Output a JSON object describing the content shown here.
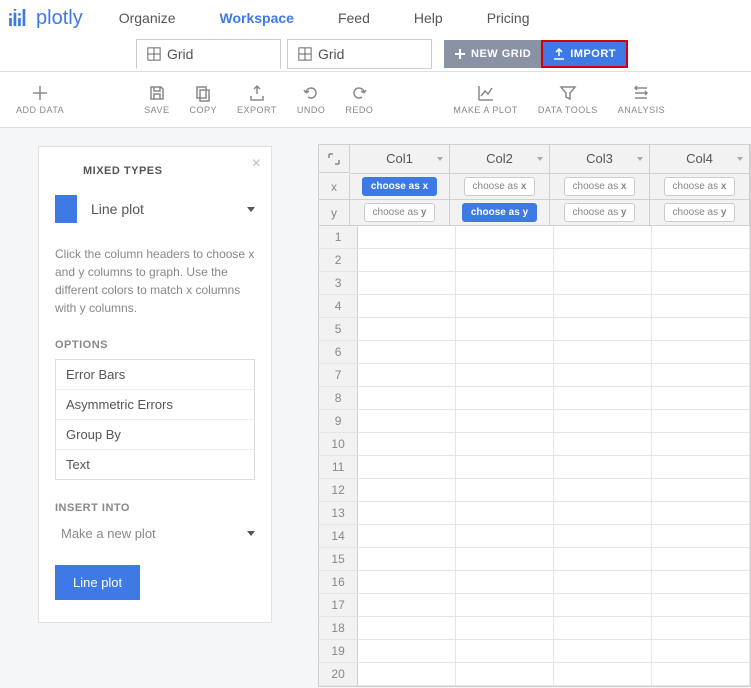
{
  "logo": "plotly",
  "nav": {
    "organize": "Organize",
    "workspace": "Workspace",
    "feed": "Feed",
    "help": "Help",
    "pricing": "Pricing"
  },
  "tabs": [
    {
      "label": "Grid"
    },
    {
      "label": "Grid"
    }
  ],
  "buttons": {
    "newgrid": "NEW GRID",
    "import": "IMPORT"
  },
  "toolbar": {
    "adddata": "ADD DATA",
    "save": "SAVE",
    "copy": "COPY",
    "export": "EXPORT",
    "undo": "UNDO",
    "redo": "REDO",
    "makeplot": "MAKE A PLOT",
    "datatools": "DATA TOOLS",
    "analysis": "ANALYSIS"
  },
  "panel": {
    "title": "MIXED TYPES",
    "plot_type": "Line plot",
    "help": "Click the column headers to choose x and y columns to graph. Use the different colors to match x columns with y columns.",
    "options_label": "OPTIONS",
    "options": [
      "Error Bars",
      "Asymmetric Errors",
      "Group By",
      "Text"
    ],
    "insert_label": "INSERT INTO",
    "insert_value": "Make a new plot",
    "action": "Line plot"
  },
  "grid": {
    "columns": [
      "Col1",
      "Col2",
      "Col3",
      "Col4"
    ],
    "axis_x": "x",
    "axis_y": "y",
    "choose_x": "choose as x",
    "choose_y": "choose as y",
    "x_selected": 0,
    "y_selected": 1,
    "rows": 20
  }
}
